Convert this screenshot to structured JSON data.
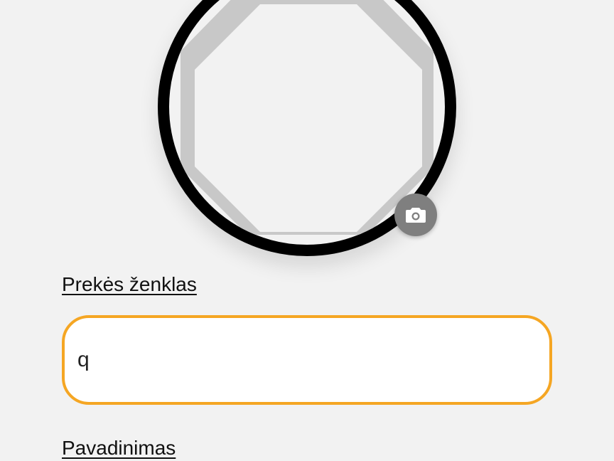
{
  "avatar": {
    "ring_color": "#000000",
    "placeholder_fill": "#c8c8c8",
    "placeholder_inner": "#f2f2f2"
  },
  "camera_button": {
    "icon": "camera-icon",
    "background": "#7f7f7f"
  },
  "form": {
    "brand_label": "Prekės ženklas",
    "brand_value": "q",
    "brand_border_color": "#f5a623",
    "name_label": "Pavadinimas"
  }
}
